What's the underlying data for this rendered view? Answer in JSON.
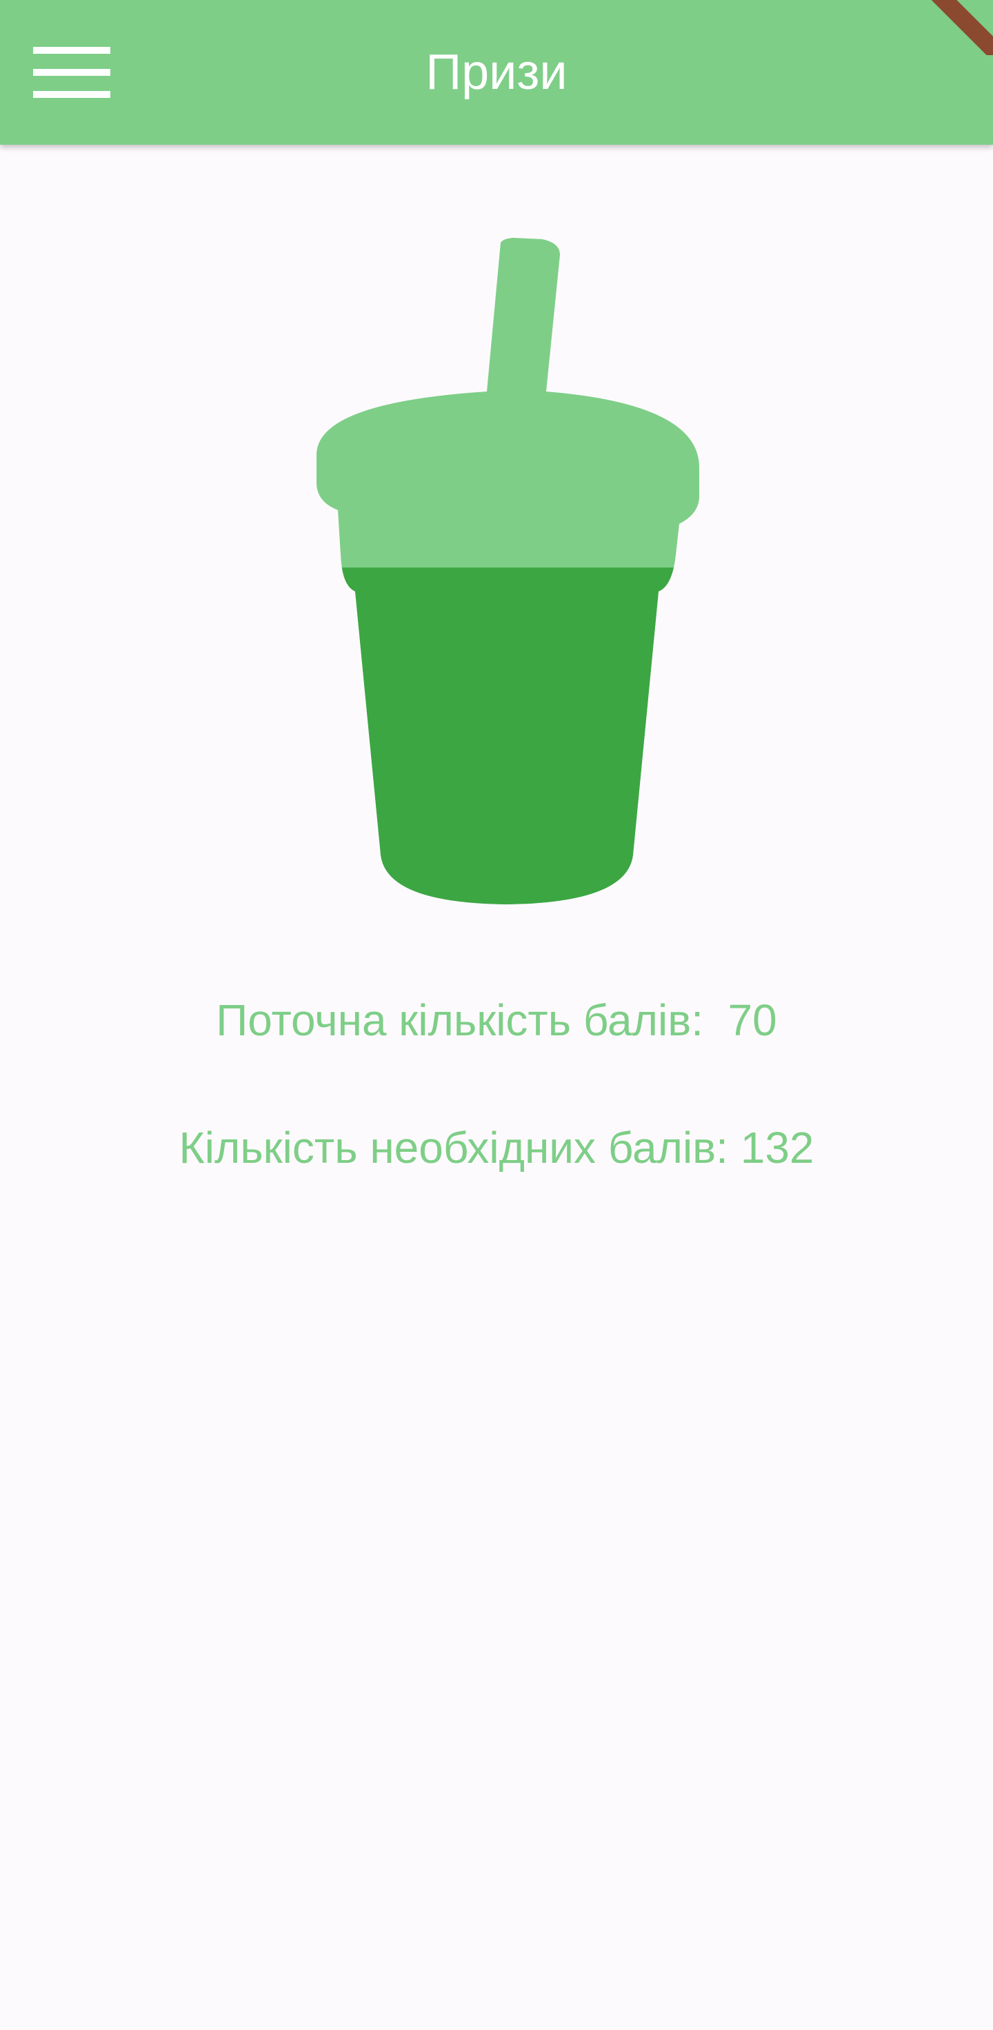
{
  "app_bar": {
    "title": "Призи",
    "menu_icon": "hamburger-menu-icon",
    "background_color": "#7ece87",
    "title_color": "#ffffff"
  },
  "prize": {
    "icon": "drink-cup-icon",
    "progress_fraction": 0.53,
    "fill_color": "#3ca643",
    "empty_color": "#7ece87"
  },
  "points": {
    "current_label": "Поточна кількість балів:",
    "current_value": "70",
    "required_label": "Кількість необхідних балів:",
    "required_value": "132",
    "text_color": "#7ece87"
  }
}
